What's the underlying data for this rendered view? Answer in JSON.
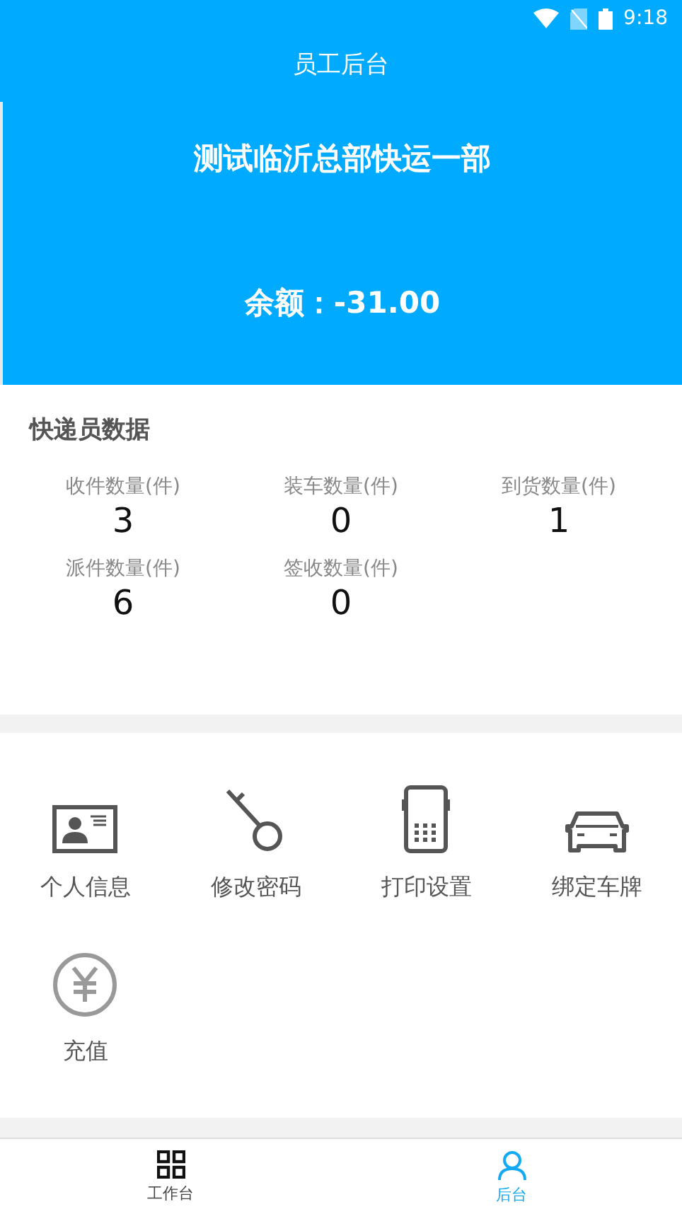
{
  "status_bar": {
    "time": "9:18"
  },
  "header": {
    "title": "员工后台"
  },
  "banner": {
    "company": "测试临沂总部快运一部",
    "balance": "余额：-31.00"
  },
  "courier_stats": {
    "title": "快递员数据",
    "items": [
      {
        "label": "收件数量(件)",
        "value": "3"
      },
      {
        "label": "装车数量(件)",
        "value": "0"
      },
      {
        "label": "到货数量(件)",
        "value": "1"
      },
      {
        "label": "派件数量(件)",
        "value": "6"
      },
      {
        "label": "签收数量(件)",
        "value": "0"
      }
    ]
  },
  "menu": [
    {
      "kind": "id-card",
      "label": "个人信息"
    },
    {
      "kind": "key",
      "label": "修改密码"
    },
    {
      "kind": "printer",
      "label": "打印设置"
    },
    {
      "kind": "car",
      "label": "绑定车牌"
    },
    {
      "kind": "yuan",
      "label": "充值"
    }
  ],
  "tab_bar": [
    {
      "kind": "grid",
      "label": "工作台",
      "selected": false
    },
    {
      "kind": "person",
      "label": "后台",
      "selected": true
    }
  ]
}
